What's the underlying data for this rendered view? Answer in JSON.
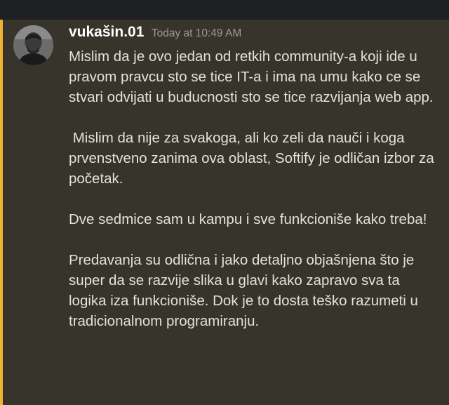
{
  "colors": {
    "highlight_bar": "#f0b232",
    "message_background": "#37342b",
    "top_bar": "#1f2023"
  },
  "message": {
    "username": "vukašin.01",
    "timestamp": "Today at 10:49 AM",
    "avatar_icon": "user-avatar-photo",
    "paragraphs": [
      "Mislim da je ovo jedan od retkih community-a koji ide u pravom pravcu sto se tice IT-a i ima na umu kako ce se stvari odvijati u buducnosti sto se tice razvijanja web app.",
      " Mislim da nije za svakoga, ali ko zeli da nauči i koga prvenstveno zanima ova oblast, Softify je odličan izbor za početak.",
      "Dve sedmice sam u kampu i sve funkcioniše kako treba!",
      "Predavanja su odlična i jako detaljno objašnjena što je super da se razvije slika u glavi kako zapravo sva ta logika iza funkcioniše. Dok je to dosta teško razumeti u tradicionalnom programiranju."
    ]
  }
}
